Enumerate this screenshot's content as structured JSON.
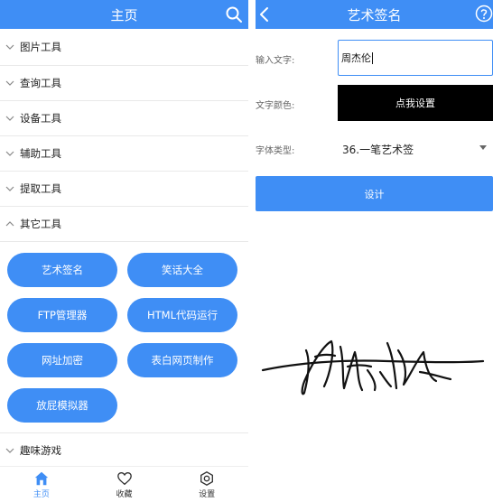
{
  "left": {
    "header": {
      "title": "主页",
      "search_icon": "search-icon"
    },
    "groups_top": [
      {
        "label": "图片工具",
        "expanded": false
      },
      {
        "label": "查询工具",
        "expanded": false
      },
      {
        "label": "设备工具",
        "expanded": false
      },
      {
        "label": "辅助工具",
        "expanded": false
      },
      {
        "label": "提取工具",
        "expanded": false
      },
      {
        "label": "其它工具",
        "expanded": true
      }
    ],
    "tool_buttons": [
      "艺术签名",
      "笑话大全",
      "FTP管理器",
      "HTML代码运行",
      "网址加密",
      "表白网页制作",
      "放屁模拟器"
    ],
    "groups_bottom": [
      {
        "label": "趣味游戏",
        "expanded": false
      }
    ],
    "tabbar": [
      {
        "label": "主页",
        "icon": "home-icon",
        "active": true
      },
      {
        "label": "收藏",
        "icon": "heart-icon",
        "active": false
      },
      {
        "label": "设置",
        "icon": "settings-icon",
        "active": false
      }
    ]
  },
  "right": {
    "header": {
      "title": "艺术签名",
      "back_icon": "back-arrow-icon",
      "help_icon": "help-icon"
    },
    "input_label": "输入文字:",
    "input_value": "周杰伦",
    "color_label": "文字颜色:",
    "color_button": "点我设置",
    "font_label": "字体类型:",
    "font_value": "36.一笔艺术签",
    "design_button": "设计"
  },
  "colors": {
    "accent": "#3f8ef5",
    "color_swatch": "#000000"
  }
}
